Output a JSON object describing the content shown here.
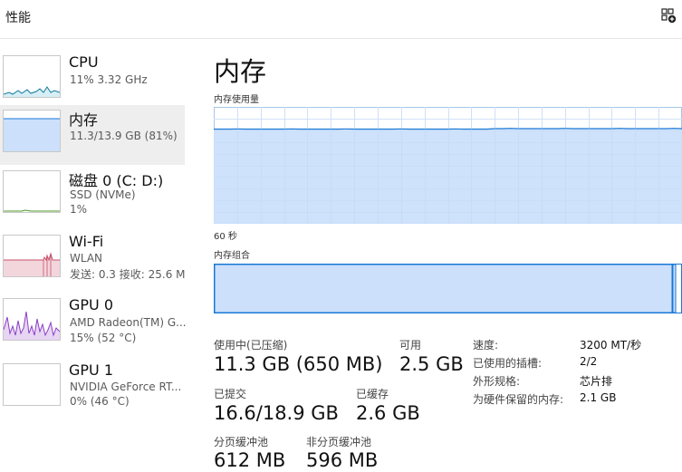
{
  "header": {
    "title": "性能",
    "icon": "add-widget-icon"
  },
  "colors": {
    "accent": "#1a78d6",
    "fill": "#cce0fb",
    "wifi": "#c8506a",
    "gpu": "#8a3fc4",
    "cpu": "#117a9c"
  },
  "sidebar": {
    "items": [
      {
        "name": "CPU",
        "sub1": "11% 3.32 GHz",
        "sub2": ""
      },
      {
        "name": "内存",
        "sub1": "11.3/13.9 GB (81%)",
        "sub2": ""
      },
      {
        "name": "磁盘 0 (C: D:)",
        "sub1": "SSD (NVMe)",
        "sub2": "1%"
      },
      {
        "name": "Wi-Fi",
        "sub1": "WLAN",
        "sub2": "发送: 0.3  接收: 25.6 M"
      },
      {
        "name": "GPU 0",
        "sub1": "AMD Radeon(TM) G...",
        "sub2": "15% (52 °C)"
      },
      {
        "name": "GPU 1",
        "sub1": "NVIDIA GeForce RT...",
        "sub2": "0% (46 °C)"
      }
    ]
  },
  "main": {
    "title": "内存",
    "usage_label": "内存使用量",
    "time_label": "60 秒",
    "composition_label": "内存组合",
    "usage_fraction": 0.81,
    "stats": {
      "in_use_label": "使用中(已压缩)",
      "in_use_value": "11.3 GB (650 MB)",
      "available_label": "可用",
      "available_value": "2.5 GB",
      "committed_label": "已提交",
      "committed_value": "16.6/18.9 GB",
      "cached_label": "已缓存",
      "cached_value": "2.6 GB",
      "paged_label": "分页缓冲池",
      "paged_value": "612 MB",
      "nonpaged_label": "非分页缓冲池",
      "nonpaged_value": "596 MB"
    },
    "specs": [
      {
        "key": "速度:",
        "value": "3200 MT/秒"
      },
      {
        "key": "已使用的插槽:",
        "value": "2/2"
      },
      {
        "key": "外形规格:",
        "value": "芯片排"
      },
      {
        "key": "为硬件保留的内存:",
        "value": "2.1 GB"
      }
    ]
  }
}
